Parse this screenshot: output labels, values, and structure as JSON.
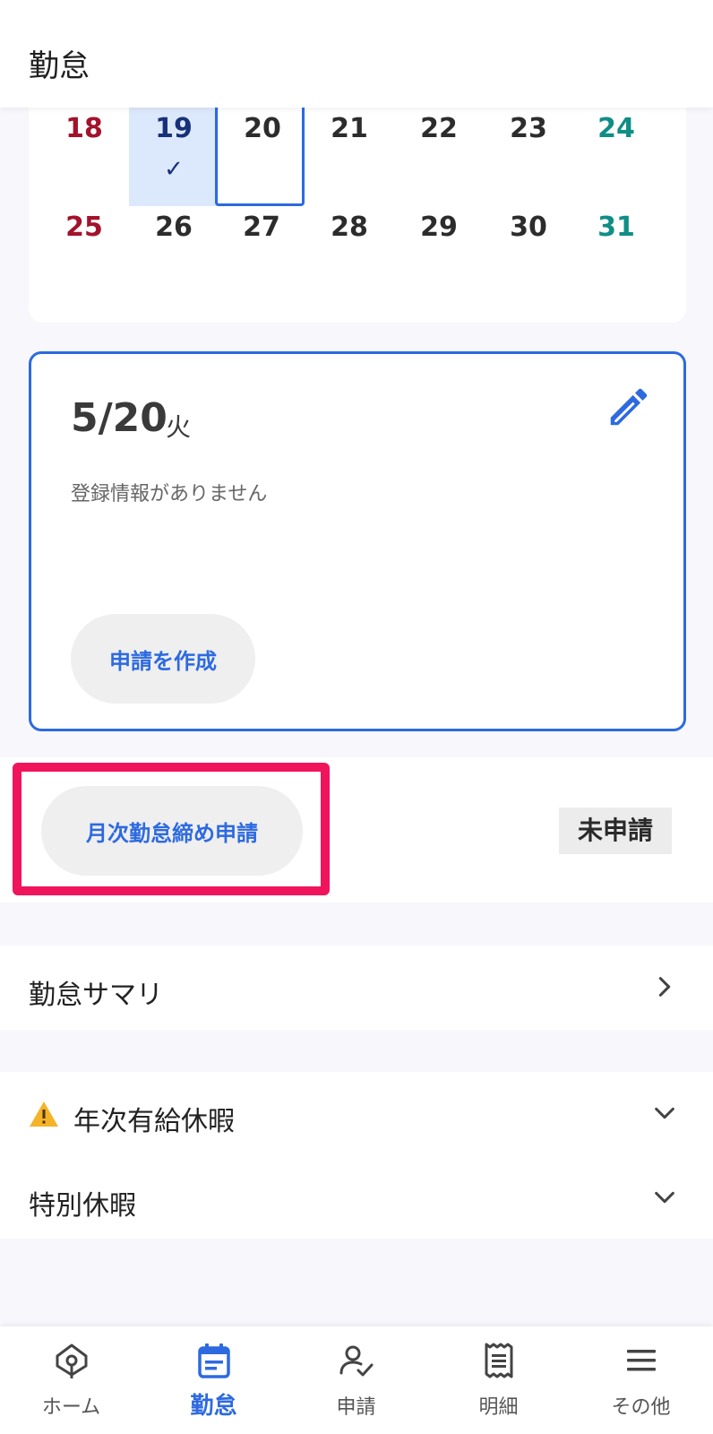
{
  "header": {
    "title": "勤怠"
  },
  "calendar": {
    "week1": [
      "18",
      "19",
      "20",
      "21",
      "22",
      "23",
      "24"
    ],
    "week2": [
      "25",
      "26",
      "27",
      "28",
      "29",
      "30",
      "31"
    ],
    "selected_day": "19",
    "today": "20",
    "check_mark": "✓"
  },
  "day_card": {
    "date": "5/20",
    "weekday": "火",
    "no_record_text": "登録情報がありません",
    "create_button_label": "申請を作成"
  },
  "monthly": {
    "button_label": "月次勤怠締め申請",
    "status": "未申請"
  },
  "list": {
    "summary_label": "勤怠サマリ",
    "annual_leave_label": "年次有給休暇",
    "special_leave_label": "特別休暇"
  },
  "nav": {
    "items": [
      {
        "label": "ホーム",
        "icon": "home-icon"
      },
      {
        "label": "勤怠",
        "icon": "calendar-icon"
      },
      {
        "label": "申請",
        "icon": "user-check-icon"
      },
      {
        "label": "明細",
        "icon": "receipt-icon"
      },
      {
        "label": "その他",
        "icon": "menu-icon"
      }
    ],
    "active_index": 1
  },
  "colors": {
    "accent": "#2d6ae0",
    "sunday": "#a3122b",
    "saturday": "#0f8e86",
    "highlight": "#f0145c",
    "warning": "#f5b32a"
  }
}
